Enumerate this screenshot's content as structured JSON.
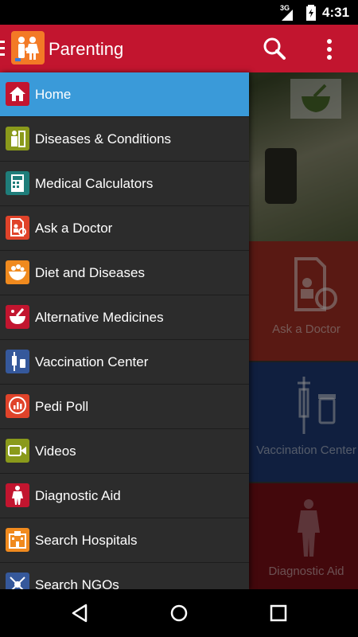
{
  "status_bar": {
    "network": "3G",
    "time": "4:31"
  },
  "toolbar": {
    "title": "Parenting",
    "search_icon": "search-icon",
    "menu_icon": "more-vert-icon"
  },
  "drawer": {
    "items": [
      {
        "label": "Home",
        "icon": "home-icon",
        "color": "#c2152f",
        "active": true
      },
      {
        "label": "Diseases & Conditions",
        "icon": "patient-icon",
        "color": "#8a9a1b"
      },
      {
        "label": "Medical Calculators",
        "icon": "calculator-icon",
        "color": "#1f7d7a"
      },
      {
        "label": "Ask a Doctor",
        "icon": "ask-doctor-icon",
        "color": "#e0432a"
      },
      {
        "label": "Diet and Diseases",
        "icon": "diet-bowl-icon",
        "color": "#f08a1e"
      },
      {
        "label": "Alternative Medicines",
        "icon": "mortar-pestle-icon",
        "color": "#c2152f"
      },
      {
        "label": "Vaccination Center",
        "icon": "syringe-icon",
        "color": "#35589b"
      },
      {
        "label": "Pedi Poll",
        "icon": "poll-bubble-icon",
        "color": "#e0432a"
      },
      {
        "label": "Videos",
        "icon": "video-icon",
        "color": "#8a9a1b"
      },
      {
        "label": "Diagnostic Aid",
        "icon": "body-icon",
        "color": "#c2152f"
      },
      {
        "label": "Search Hospitals",
        "icon": "hospital-icon",
        "color": "#f08a1e"
      },
      {
        "label": "Search NGOs",
        "icon": "ngo-icon",
        "color": "#35589b"
      }
    ]
  },
  "background_tiles": {
    "ask_doctor": "Ask a Doctor",
    "vaccination": "Vaccination Center",
    "diagnostic": "Diagnostic Aid"
  },
  "colors": {
    "toolbar": "#c2152f",
    "drawer_active": "#3a9ad9",
    "drawer_bg": "#2c2c2c"
  }
}
